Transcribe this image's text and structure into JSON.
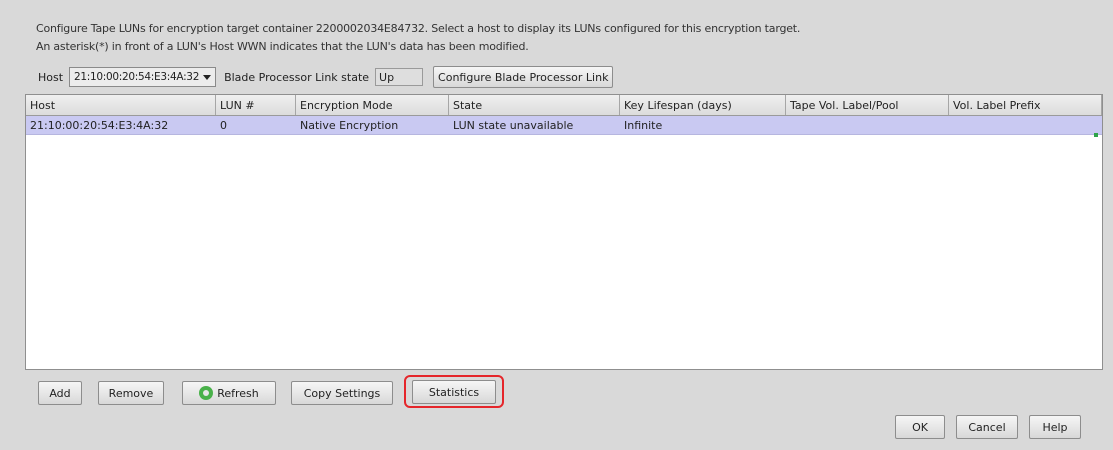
{
  "description": {
    "line1": "Configure Tape LUNs for encryption target container 2200002034E84732. Select a host to display its LUNs configured for this encryption target.",
    "line2": "An asterisk(*) in front of a LUN's Host WWN indicates that the LUN's data has been modified."
  },
  "host_row": {
    "host_label": "Host",
    "host_value": "21:10:00:20:54:E3:4A:32",
    "link_state_label": "Blade Processor Link state",
    "link_state_value": "Up",
    "configure_link_label": "Configure Blade Processor Link"
  },
  "table": {
    "columns": [
      "Host",
      "LUN #",
      "Encryption Mode",
      "State",
      "Key Lifespan (days)",
      "Tape Vol. Label/Pool",
      "Vol. Label Prefix"
    ],
    "rows": [
      [
        "21:10:00:20:54:E3:4A:32",
        "0",
        "Native Encryption",
        "LUN state unavailable",
        "Infinite",
        "",
        ""
      ]
    ]
  },
  "buttons": {
    "add": "Add",
    "remove": "Remove",
    "refresh": "Refresh",
    "copy_settings": "Copy Settings",
    "statistics": "Statistics",
    "ok": "OK",
    "cancel": "Cancel",
    "help": "Help"
  },
  "icons": {
    "host_dropdown": "chevron-down-icon",
    "refresh": "refresh-icon"
  },
  "colors": {
    "selected_row": "#c9c9f2",
    "highlight": "#e5262b",
    "refresh_icon": "#49b14a"
  }
}
